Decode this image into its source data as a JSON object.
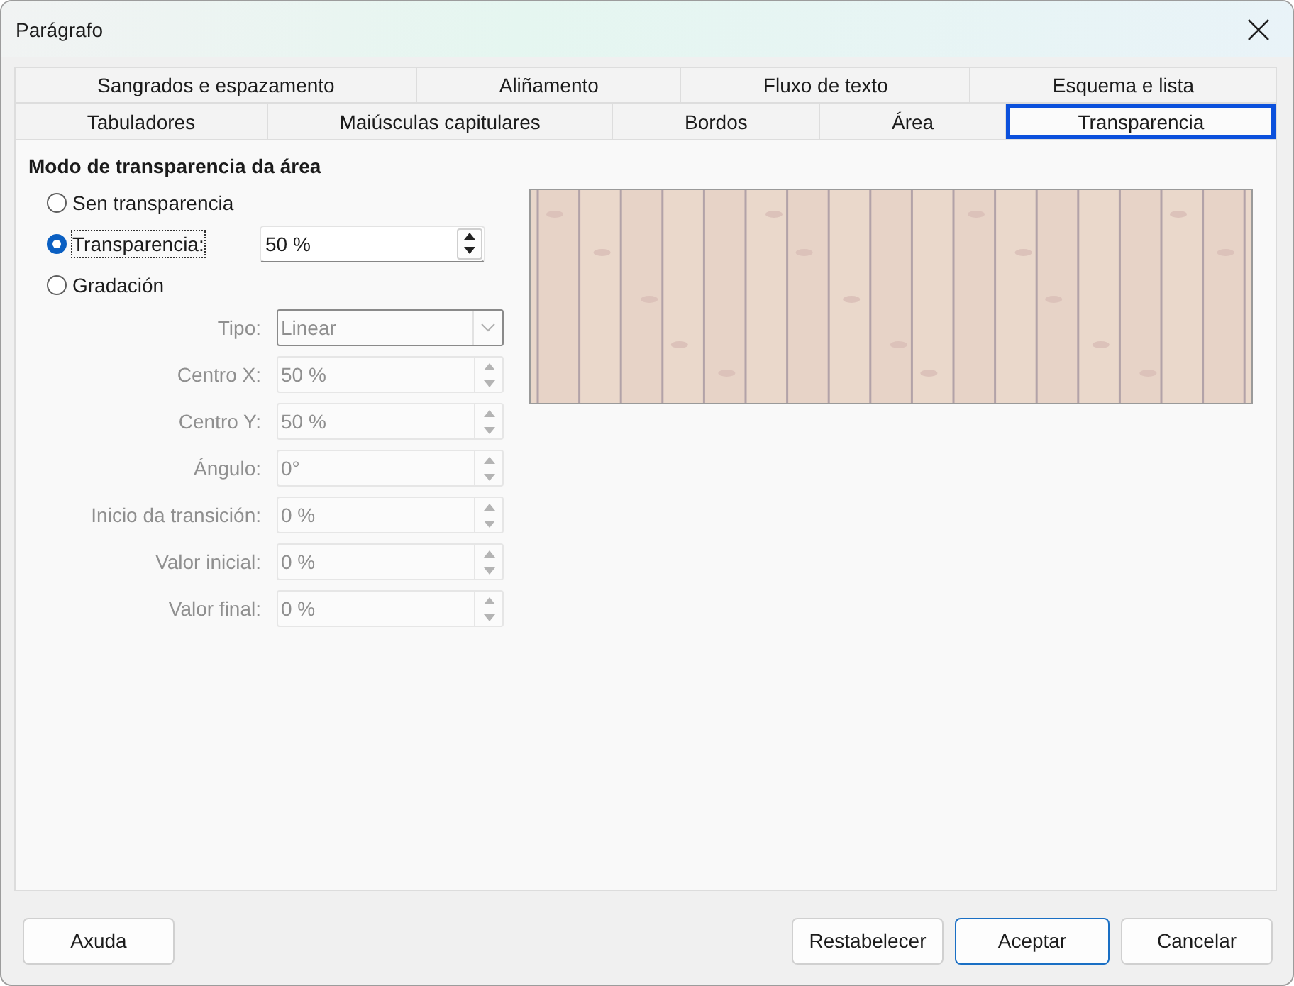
{
  "window": {
    "title": "Parágrafo"
  },
  "tab_rows": [
    {
      "tabs": [
        {
          "label": "Sangrados e espazamento",
          "selected": false
        },
        {
          "label": "Aliñamento",
          "selected": false
        },
        {
          "label": "Fluxo de texto",
          "selected": false
        },
        {
          "label": "Esquema e lista",
          "selected": false
        }
      ]
    },
    {
      "tabs": [
        {
          "label": "Tabuladores",
          "selected": false
        },
        {
          "label": "Maiúsculas capitulares",
          "selected": false
        },
        {
          "label": "Bordos",
          "selected": false
        },
        {
          "label": "Área",
          "selected": false
        },
        {
          "label": "Transparencia",
          "selected": true
        }
      ]
    }
  ],
  "transparency_mode": {
    "heading": "Modo de transparencia da área",
    "options": [
      {
        "label": "Sen transparencia",
        "selected": false,
        "focused": false
      },
      {
        "label": "Transparencia:",
        "selected": true,
        "focused": true,
        "value": "50 %"
      },
      {
        "label": "Gradación",
        "selected": false,
        "focused": false
      }
    ],
    "gradient": {
      "disabled": true,
      "fields": [
        {
          "kind": "dropdown",
          "label": "Tipo:",
          "value": "Linear"
        },
        {
          "kind": "spin",
          "label": "Centro X:",
          "value": "50 %"
        },
        {
          "kind": "spin",
          "label": "Centro Y:",
          "value": "50 %"
        },
        {
          "kind": "spin",
          "label": "Ángulo:",
          "value": "0°"
        },
        {
          "kind": "spin",
          "label": "Inicio da transición:",
          "value": "0 %"
        },
        {
          "kind": "spin",
          "label": "Valor inicial:",
          "value": "0 %"
        },
        {
          "kind": "spin",
          "label": "Valor final:",
          "value": "0 %"
        }
      ]
    }
  },
  "footer": {
    "left_buttons": [
      {
        "label": "Axuda",
        "default": false
      }
    ],
    "right_buttons": [
      {
        "label": "Restabelecer",
        "default": false
      },
      {
        "label": "Aceptar",
        "default": true
      },
      {
        "label": "Cancelar",
        "default": false
      }
    ]
  }
}
